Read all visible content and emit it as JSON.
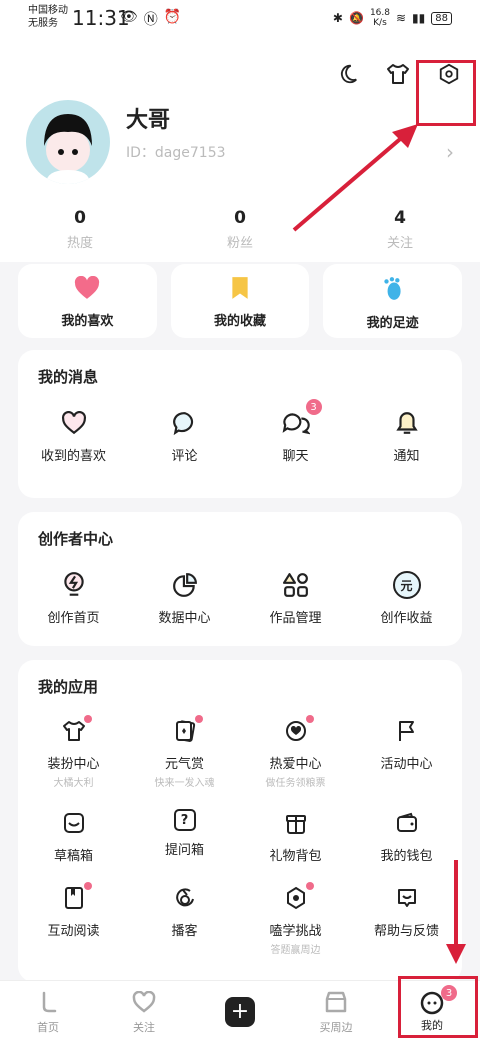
{
  "status_bar": {
    "carrier_line1": "中国移动",
    "carrier_line2": "无服务",
    "time": "11:31",
    "speed": "16.8",
    "speed_unit": "K/s",
    "battery": "88"
  },
  "profile": {
    "name": "大哥",
    "id": "ID：dage7153",
    "stats": [
      {
        "value": "0",
        "label": "热度"
      },
      {
        "value": "0",
        "label": "粉丝"
      },
      {
        "value": "4",
        "label": "关注"
      }
    ]
  },
  "quick_links": [
    {
      "label": "我的喜欢",
      "icon": "heart-icon",
      "color": "#f36b8a"
    },
    {
      "label": "我的收藏",
      "icon": "bookmark-icon",
      "color": "#f6c545"
    },
    {
      "label": "我的足迹",
      "icon": "footprint-icon",
      "color": "#3fb3e8"
    }
  ],
  "messages": {
    "title": "我的消息",
    "items": [
      {
        "label": "收到的喜欢",
        "icon": "heart-outline-icon"
      },
      {
        "label": "评论",
        "icon": "comment-icon"
      },
      {
        "label": "聊天",
        "icon": "chat-icon",
        "badge": "3"
      },
      {
        "label": "通知",
        "icon": "bell-icon"
      }
    ]
  },
  "creator": {
    "title": "创作者中心",
    "items": [
      {
        "label": "创作首页",
        "icon": "bulb-icon"
      },
      {
        "label": "数据中心",
        "icon": "pie-chart-icon"
      },
      {
        "label": "作品管理",
        "icon": "shapes-icon"
      },
      {
        "label": "创作收益",
        "icon": "yuan-coin-icon",
        "glyph": "元"
      }
    ]
  },
  "apps": {
    "title": "我的应用",
    "items": [
      {
        "label": "装扮中心",
        "sub": "大橘大利",
        "icon": "shirt-icon",
        "dot": true
      },
      {
        "label": "元气赏",
        "sub": "快来一发入魂",
        "icon": "cards-icon",
        "dot": true
      },
      {
        "label": "热爱中心",
        "sub": "做任务领粮票",
        "icon": "heart-badge-icon",
        "dot": true
      },
      {
        "label": "活动中心",
        "sub": "",
        "icon": "flag-icon",
        "dot": false
      },
      {
        "label": "草稿箱",
        "sub": "",
        "icon": "draft-box-icon",
        "dot": false
      },
      {
        "label": "提问箱",
        "sub": "",
        "icon": "question-box-icon",
        "dot": false,
        "glyph": "?"
      },
      {
        "label": "礼物背包",
        "sub": "",
        "icon": "gift-icon",
        "dot": false
      },
      {
        "label": "我的钱包",
        "sub": "",
        "icon": "wallet-icon",
        "dot": false
      },
      {
        "label": "互动阅读",
        "sub": "",
        "icon": "book-icon",
        "dot": true
      },
      {
        "label": "播客",
        "sub": "",
        "icon": "podcast-icon",
        "dot": false
      },
      {
        "label": "嗑学挑战",
        "sub": "答题赢周边",
        "icon": "challenge-icon",
        "dot": true
      },
      {
        "label": "帮助与反馈",
        "sub": "",
        "icon": "help-feedback-icon",
        "dot": false
      }
    ]
  },
  "tabbar": [
    {
      "label": "首页",
      "icon": "home-icon"
    },
    {
      "label": "关注",
      "icon": "follow-icon"
    },
    {
      "label": "",
      "icon": "plus-icon"
    },
    {
      "label": "买周边",
      "icon": "shop-icon"
    },
    {
      "label": "我的",
      "icon": "me-icon",
      "badge": "3",
      "active": true
    }
  ],
  "accent_color": "#d8203a"
}
